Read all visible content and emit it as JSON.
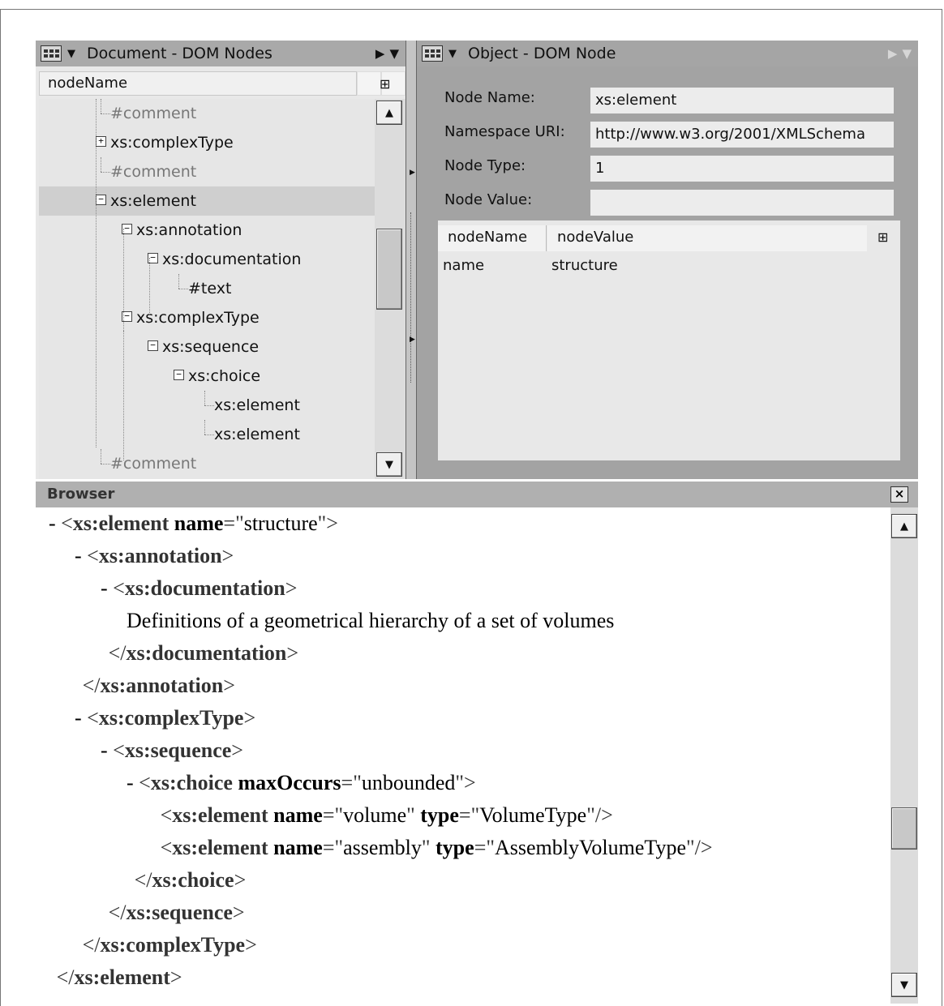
{
  "left_pane": {
    "title": "Document - DOM Nodes",
    "column_header": "nodeName",
    "tree": [
      {
        "label": "#comment",
        "muted": true,
        "depth": 2,
        "toggle": ""
      },
      {
        "label": "xs:complexType",
        "muted": false,
        "depth": 2,
        "toggle": "+"
      },
      {
        "label": "#comment",
        "muted": true,
        "depth": 2,
        "toggle": ""
      },
      {
        "label": "xs:element",
        "muted": false,
        "depth": 2,
        "toggle": "-",
        "selected": true
      },
      {
        "label": "xs:annotation",
        "muted": false,
        "depth": 3,
        "toggle": "-"
      },
      {
        "label": "xs:documentation",
        "muted": false,
        "depth": 4,
        "toggle": "-"
      },
      {
        "label": "#text",
        "muted": false,
        "depth": 5,
        "toggle": ""
      },
      {
        "label": "xs:complexType",
        "muted": false,
        "depth": 3,
        "toggle": "-"
      },
      {
        "label": "xs:sequence",
        "muted": false,
        "depth": 4,
        "toggle": "-"
      },
      {
        "label": "xs:choice",
        "muted": false,
        "depth": 5,
        "toggle": "-"
      },
      {
        "label": "xs:element",
        "muted": false,
        "depth": 6,
        "toggle": ""
      },
      {
        "label": "xs:element",
        "muted": false,
        "depth": 6,
        "toggle": ""
      },
      {
        "label": "#comment",
        "muted": true,
        "depth": 2,
        "toggle": ""
      }
    ]
  },
  "right_pane": {
    "title": "Object - DOM Node",
    "props": {
      "node_name_label": "Node Name:",
      "node_name_value": "xs:element",
      "namespace_label": "Namespace URI:",
      "namespace_value": "http://www.w3.org/2001/XMLSchema",
      "node_type_label": "Node Type:",
      "node_type_value": "1",
      "node_value_label": "Node Value:",
      "node_value_value": ""
    },
    "attributes": {
      "col_name": "nodeName",
      "col_value": "nodeValue",
      "rows": [
        {
          "name": "name",
          "value": "structure"
        }
      ]
    }
  },
  "browser": {
    "title": "Browser",
    "close_label": "×",
    "lines": [
      {
        "indent": 0,
        "parts": [
          [
            "dash",
            "- "
          ],
          [
            "punct",
            "<"
          ],
          [
            "tag",
            "xs:element "
          ],
          [
            "attr",
            "name"
          ],
          [
            "punct",
            "=\""
          ],
          [
            "val",
            "structure"
          ],
          [
            "punct",
            "\">"
          ]
        ]
      },
      {
        "indent": 1,
        "parts": [
          [
            "dash",
            "- "
          ],
          [
            "punct",
            "<"
          ],
          [
            "tag",
            "xs:annotation"
          ],
          [
            "punct",
            ">"
          ]
        ]
      },
      {
        "indent": 2,
        "parts": [
          [
            "dash",
            "- "
          ],
          [
            "punct",
            "<"
          ],
          [
            "tag",
            "xs:documentation"
          ],
          [
            "punct",
            ">"
          ]
        ]
      },
      {
        "indent": 3,
        "parts": [
          [
            "txt",
            "Definitions of a geometrical hierarchy of a set of volumes"
          ]
        ]
      },
      {
        "indent": 2.3,
        "parts": [
          [
            "punct",
            "</"
          ],
          [
            "tag",
            "xs:documentation"
          ],
          [
            "punct",
            ">"
          ]
        ]
      },
      {
        "indent": 1.3,
        "parts": [
          [
            "punct",
            "</"
          ],
          [
            "tag",
            "xs:annotation"
          ],
          [
            "punct",
            ">"
          ]
        ]
      },
      {
        "indent": 1,
        "parts": [
          [
            "dash",
            "- "
          ],
          [
            "punct",
            "<"
          ],
          [
            "tag",
            "xs:complexType"
          ],
          [
            "punct",
            ">"
          ]
        ]
      },
      {
        "indent": 2,
        "parts": [
          [
            "dash",
            "- "
          ],
          [
            "punct",
            "<"
          ],
          [
            "tag",
            "xs:sequence"
          ],
          [
            "punct",
            ">"
          ]
        ]
      },
      {
        "indent": 3,
        "parts": [
          [
            "dash",
            "- "
          ],
          [
            "punct",
            "<"
          ],
          [
            "tag",
            "xs:choice "
          ],
          [
            "attr",
            "maxOccurs"
          ],
          [
            "punct",
            "=\""
          ],
          [
            "val",
            "unbounded"
          ],
          [
            "punct",
            "\">"
          ]
        ]
      },
      {
        "indent": 4.3,
        "parts": [
          [
            "punct",
            "<"
          ],
          [
            "tag",
            "xs:element "
          ],
          [
            "attr",
            "name"
          ],
          [
            "punct",
            "=\""
          ],
          [
            "val",
            "volume"
          ],
          [
            "punct",
            "\" "
          ],
          [
            "attr",
            "type"
          ],
          [
            "punct",
            "=\""
          ],
          [
            "val",
            "VolumeType"
          ],
          [
            "punct",
            "\"/>"
          ]
        ]
      },
      {
        "indent": 4.3,
        "parts": [
          [
            "punct",
            "<"
          ],
          [
            "tag",
            "xs:element "
          ],
          [
            "attr",
            "name"
          ],
          [
            "punct",
            "=\""
          ],
          [
            "val",
            "assembly"
          ],
          [
            "punct",
            "\" "
          ],
          [
            "attr",
            "type"
          ],
          [
            "punct",
            "=\""
          ],
          [
            "val",
            "AssemblyVolumeType"
          ],
          [
            "punct",
            "\"/>"
          ]
        ]
      },
      {
        "indent": 3.3,
        "parts": [
          [
            "punct",
            "</"
          ],
          [
            "tag",
            "xs:choice"
          ],
          [
            "punct",
            ">"
          ]
        ]
      },
      {
        "indent": 2.3,
        "parts": [
          [
            "punct",
            "</"
          ],
          [
            "tag",
            "xs:sequence"
          ],
          [
            "punct",
            ">"
          ]
        ]
      },
      {
        "indent": 1.3,
        "parts": [
          [
            "punct",
            "</"
          ],
          [
            "tag",
            "xs:complexType"
          ],
          [
            "punct",
            ">"
          ]
        ]
      },
      {
        "indent": 0.3,
        "parts": [
          [
            "punct",
            "</"
          ],
          [
            "tag",
            "xs:element"
          ],
          [
            "punct",
            ">"
          ]
        ]
      }
    ]
  },
  "icons": {
    "grid": "grid-icon",
    "caret": "caret-down-icon",
    "column_chooser": "column-chooser-icon",
    "scroll_up": "scroll-up-icon",
    "scroll_down": "scroll-down-icon",
    "close": "close-icon"
  },
  "glyphs": {
    "caret": "▼",
    "nav_right": "▶",
    "nav_down": "▼",
    "column_chooser": "⊞",
    "up": "▲",
    "down": "▼"
  }
}
